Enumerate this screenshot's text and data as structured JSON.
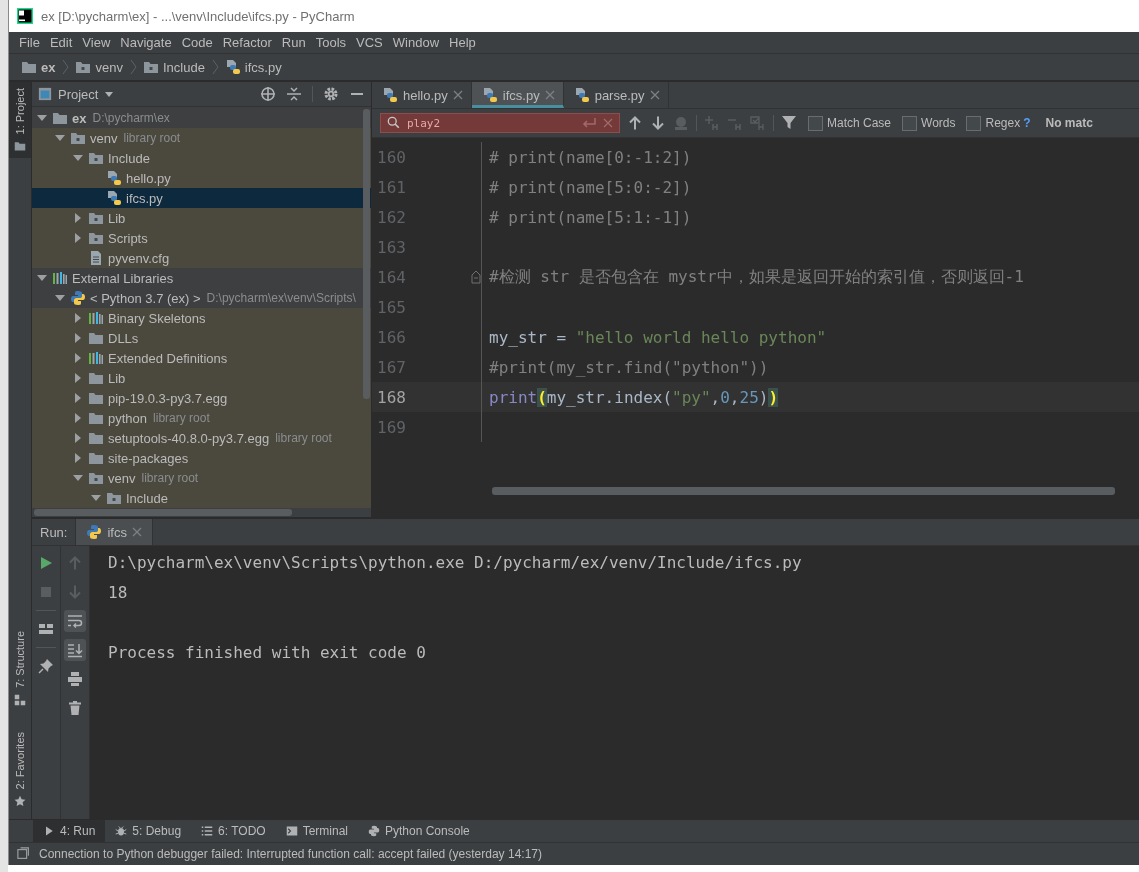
{
  "window": {
    "title": "ex [D:\\pycharm\\ex] - ...\\venv\\Include\\ifcs.py - PyCharm"
  },
  "menu": [
    "File",
    "Edit",
    "View",
    "Navigate",
    "Code",
    "Refactor",
    "Run",
    "Tools",
    "VCS",
    "Window",
    "Help"
  ],
  "breadcrumb": [
    {
      "label": "ex",
      "kind": "project-root"
    },
    {
      "label": "venv",
      "kind": "module-folder"
    },
    {
      "label": "Include",
      "kind": "module-folder"
    },
    {
      "label": "ifcs.py",
      "kind": "python-file"
    }
  ],
  "left_strip": {
    "top": [
      {
        "label": "1: Project",
        "kind": "folder",
        "selected": true
      }
    ],
    "bottom": [
      {
        "label": "7: Structure",
        "kind": "structure",
        "selected": false
      },
      {
        "label": "2: Favorites",
        "kind": "star",
        "selected": false
      }
    ]
  },
  "project": {
    "title": "Project",
    "tree": [
      {
        "label": "ex",
        "hint": "D:\\pycharm\\ex",
        "kind": "project-root",
        "expanded": true,
        "selected": false,
        "color": "#3d3f40",
        "children": [
          {
            "label": "venv",
            "hint": "library root",
            "kind": "module-folder",
            "expanded": true,
            "selected": false,
            "color": "#4b483d",
            "children": [
              {
                "label": "Include",
                "kind": "module-folder",
                "expanded": true,
                "selected": false,
                "color": "#4b483d",
                "children": [
                  {
                    "label": "hello.py",
                    "kind": "python-file",
                    "selected": false,
                    "color": "#4b483d"
                  },
                  {
                    "label": "ifcs.py",
                    "kind": "python-file",
                    "selected": true
                  }
                ]
              },
              {
                "label": "Lib",
                "kind": "module-folder",
                "expanded": false,
                "selected": false,
                "color": "#4b483d"
              },
              {
                "label": "Scripts",
                "kind": "module-folder",
                "expanded": false,
                "selected": false,
                "color": "#4b483d"
              },
              {
                "label": "pyvenv.cfg",
                "kind": "config-file",
                "selected": false,
                "color": "#4b483d"
              }
            ]
          }
        ]
      },
      {
        "label": "External Libraries",
        "kind": "library",
        "expanded": true,
        "selected": false,
        "color": "#3d3f40",
        "children": [
          {
            "label": "< Python 3.7 (ex) >",
            "hint": "D:\\pycharm\\ex\\venv\\Scripts\\",
            "kind": "python-sdk",
            "expanded": true,
            "selected": false,
            "color": "#3d3f40",
            "children": [
              {
                "label": "Binary Skeletons",
                "kind": "library",
                "expanded": false,
                "selected": false,
                "color": "#4b483d"
              },
              {
                "label": "DLLs",
                "kind": "folder",
                "expanded": false,
                "selected": false,
                "color": "#4b483d"
              },
              {
                "label": "Extended Definitions",
                "kind": "library",
                "expanded": false,
                "selected": false,
                "color": "#4b483d"
              },
              {
                "label": "Lib",
                "kind": "folder",
                "expanded": false,
                "selected": false,
                "color": "#4b483d"
              },
              {
                "label": "pip-19.0.3-py3.7.egg",
                "kind": "folder",
                "expanded": false,
                "selected": false,
                "color": "#4b483d"
              },
              {
                "label": "python",
                "hint": "library root",
                "kind": "folder",
                "expanded": false,
                "selected": false,
                "color": "#4b483d"
              },
              {
                "label": "setuptools-40.8.0-py3.7.egg",
                "hint": "library root",
                "kind": "folder",
                "expanded": false,
                "selected": false,
                "color": "#4b483d"
              },
              {
                "label": "site-packages",
                "kind": "folder",
                "expanded": false,
                "selected": false,
                "color": "#4b483d"
              },
              {
                "label": "venv",
                "hint": "library root",
                "kind": "module-folder",
                "expanded": true,
                "selected": false,
                "color": "#4b483d",
                "children": [
                  {
                    "label": "Include",
                    "kind": "module-folder",
                    "expanded": true,
                    "selected": false,
                    "color": "#4b483d"
                  }
                ]
              }
            ]
          }
        ]
      }
    ]
  },
  "editor": {
    "tabs": [
      {
        "label": "hello.py",
        "selected": false
      },
      {
        "label": "ifcs.py",
        "selected": true
      },
      {
        "label": "parse.py",
        "selected": false
      }
    ],
    "find": {
      "value": "play2",
      "tools": [
        {
          "kind": "up",
          "disabled": false
        },
        {
          "kind": "down",
          "disabled": false
        },
        {
          "kind": "find-all",
          "disabled": true
        },
        {
          "kind": "add-occurrence",
          "disabled": true
        },
        {
          "kind": "remove-occurrence",
          "disabled": true
        },
        {
          "kind": "select-all",
          "disabled": true
        },
        {
          "kind": "filter",
          "disabled": false
        }
      ],
      "options": [
        {
          "label": "Match Case",
          "checked": false
        },
        {
          "label": "Words",
          "checked": false
        },
        {
          "label": "Regex",
          "checked": false
        }
      ],
      "help": "?",
      "result": "No matc"
    },
    "lines": [
      {
        "number": "160",
        "current": false,
        "fold": false,
        "tokens": [
          {
            "kind": "comment",
            "text": "# print(name[0:-1:2])"
          }
        ]
      },
      {
        "number": "161",
        "current": false,
        "fold": false,
        "tokens": [
          {
            "kind": "comment",
            "text": "# print(name[5:0:-2])"
          }
        ]
      },
      {
        "number": "162",
        "current": false,
        "fold": false,
        "tokens": [
          {
            "kind": "comment",
            "text": "# print(name[5:1:-1])"
          }
        ]
      },
      {
        "number": "163",
        "current": false,
        "fold": false
      },
      {
        "number": "164",
        "current": false,
        "fold": true,
        "tokens": [
          {
            "kind": "comment",
            "text": "#检测 str 是否包含在 mystr中，如果是返回开始的索引值，否则返回-1"
          }
        ]
      },
      {
        "number": "165",
        "current": false,
        "fold": false
      },
      {
        "number": "166",
        "current": false,
        "fold": false,
        "tokens": [
          {
            "kind": "text",
            "text": "my_str = "
          },
          {
            "kind": "string",
            "text": "\"hello world hello python\""
          }
        ]
      },
      {
        "number": "167",
        "current": false,
        "fold": false,
        "tokens": [
          {
            "kind": "comment",
            "text": "#print(my_str.find(\"python\"))"
          }
        ]
      },
      {
        "number": "168",
        "current": true,
        "fold": false,
        "tokens": [
          {
            "kind": "builtin",
            "text": "print"
          },
          {
            "kind": "brace",
            "text": "("
          },
          {
            "kind": "text",
            "text": "my_str.index("
          },
          {
            "kind": "string",
            "text": "\"py\""
          },
          {
            "kind": "text",
            "text": ","
          },
          {
            "kind": "number",
            "text": "0"
          },
          {
            "kind": "text",
            "text": ","
          },
          {
            "kind": "number",
            "text": "25"
          },
          {
            "kind": "text",
            "text": ")"
          },
          {
            "kind": "brace",
            "text": ")"
          }
        ]
      },
      {
        "number": "169",
        "current": false,
        "fold": false
      }
    ]
  },
  "run": {
    "label": "Run:",
    "tabs": [
      {
        "label": "ifcs",
        "selected": true
      }
    ],
    "toolbars": [
      {
        "tools": [
          {
            "kind": "rerun",
            "disabled": false,
            "on": false
          },
          {
            "kind": "stop",
            "disabled": true,
            "on": false
          },
          {
            "kind": "layout",
            "disabled": false,
            "on": false
          },
          {
            "kind": "pin",
            "disabled": false,
            "on": false
          }
        ]
      },
      {
        "tools": [
          {
            "kind": "up",
            "disabled": true,
            "on": false
          },
          {
            "kind": "down",
            "disabled": true,
            "on": false
          },
          {
            "kind": "wrap",
            "disabled": false,
            "on": true
          },
          {
            "kind": "scroll-end",
            "disabled": false,
            "on": true
          },
          {
            "kind": "print",
            "disabled": false,
            "on": false
          },
          {
            "kind": "trash",
            "disabled": false,
            "on": false
          }
        ]
      }
    ],
    "output": [
      {
        "text": "D:\\pycharm\\ex\\venv\\Scripts\\python.exe D:/pycharm/ex/venv/Include/ifcs.py",
        "kind": "command"
      },
      {
        "text": "18",
        "kind": "result"
      },
      {
        "text": "Process finished with exit code 0",
        "kind": "exit"
      }
    ]
  },
  "tool_tabs": [
    {
      "label": "4: Run",
      "kind": "run",
      "selected": true
    },
    {
      "label": "5: Debug",
      "kind": "debug",
      "selected": false
    },
    {
      "label": "6: TODO",
      "kind": "todo",
      "selected": false
    },
    {
      "label": "Terminal",
      "kind": "terminal",
      "selected": false
    },
    {
      "label": "Python Console",
      "kind": "python-console",
      "selected": false
    }
  ],
  "status_bar": {
    "message": "Connection to Python debugger failed: Interrupted function call: accept failed (yesterday 14:17)"
  }
}
